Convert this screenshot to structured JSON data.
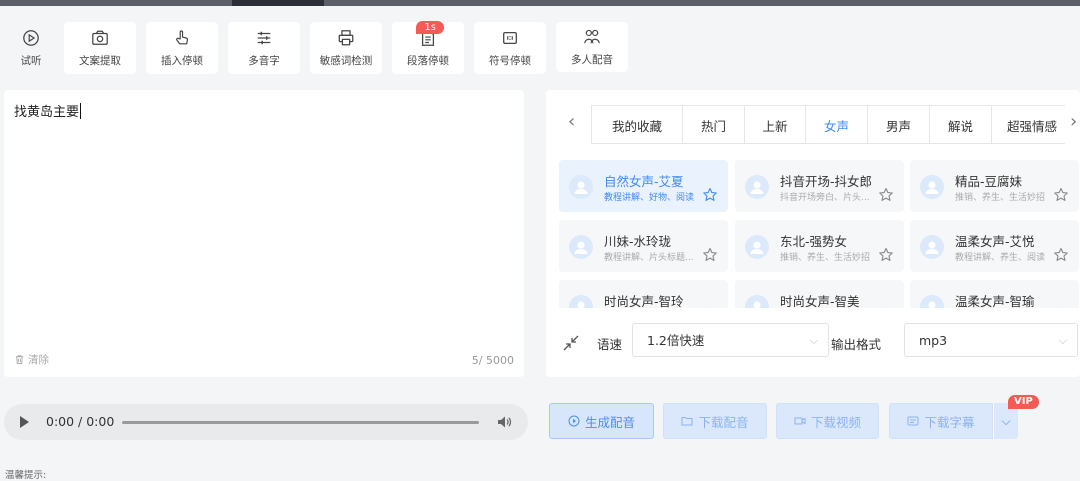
{
  "toolbar": {
    "items": [
      {
        "label": "试听",
        "icon": "play-circle-icon"
      },
      {
        "label": "文案提取",
        "icon": "camera-icon"
      },
      {
        "label": "插入停顿",
        "icon": "hand-pointer-icon"
      },
      {
        "label": "多音字",
        "icon": "sliders-icon"
      },
      {
        "label": "敏感词检测",
        "icon": "printer-icon"
      },
      {
        "label": "段落停顿",
        "icon": "document-icon",
        "badge": "1s"
      },
      {
        "label": "符号停顿",
        "icon": "pause-symbol-icon"
      },
      {
        "label": "多人配音",
        "icon": "multi-user-icon"
      }
    ]
  },
  "editor": {
    "text": "找黄岛主要",
    "clear_label": "清除",
    "char_count": "5/ 5000"
  },
  "voice_panel": {
    "tabs": [
      "我的收藏",
      "热门",
      "上新",
      "女声",
      "男声",
      "解说",
      "超强情感"
    ],
    "active_tab": "女声",
    "voices": [
      {
        "name": "自然女声-艾夏",
        "tags": "教程讲解、好物、阅读",
        "selected": true
      },
      {
        "name": "抖音开场-抖女郎",
        "tags": "抖音开场旁白、片头..."
      },
      {
        "name": "精品-豆腐妹",
        "tags": "推销、养生、生活妙招"
      },
      {
        "name": "川妹-水玲珑",
        "tags": "教程讲解、片头标题..."
      },
      {
        "name": "东北-强势女",
        "tags": "推销、养生、生活妙招"
      },
      {
        "name": "温柔女声-艾悦",
        "tags": "教程讲解、养生、阅读"
      },
      {
        "name": "时尚女声-智玲",
        "tags": ""
      },
      {
        "name": "时尚女声-智美",
        "tags": ""
      },
      {
        "name": "温柔女声-智瑜",
        "tags": ""
      }
    ],
    "speed_label": "语速",
    "speed_value": "1.2倍快速",
    "format_label": "输出格式",
    "format_value": "mp3"
  },
  "audio": {
    "time": "0:00 / 0:00"
  },
  "actions": {
    "generate": "生成配音",
    "download_audio": "下载配音",
    "download_video": "下载视频",
    "download_subtitle": "下载字幕",
    "vip_badge": "VIP"
  },
  "tip": "温馨提示:",
  "colors": {
    "accent": "#3d8bff",
    "badge_red": "#f25c54",
    "selected_card_bg": "#eaf2fe"
  }
}
